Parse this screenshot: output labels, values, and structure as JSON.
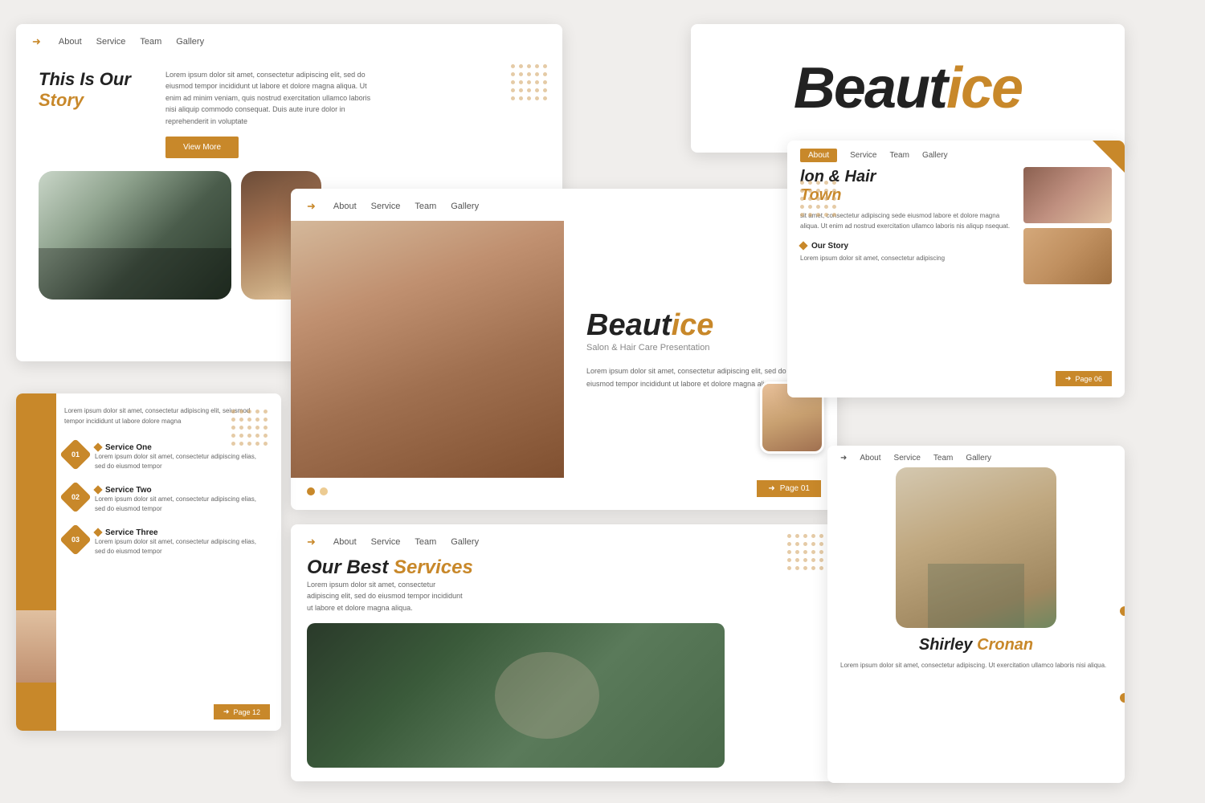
{
  "brand": {
    "name_part1": "Beaut",
    "name_part2": "ice",
    "tagline": "Salon & Hair Care Presentation"
  },
  "slide1": {
    "title_line1": "This Is Our",
    "title_line2": "Story",
    "body": "Lorem ipsum dolor sit amet, consectetur adipiscing elit, sed do eiusmod tempor incididunt ut labore et dolore magna aliqua. Ut enim ad minim veniam, quis nostrud exercitation ullamco laboris nisi aliquip commodo consequat. Duis aute irure dolor in reprehenderit in voluptate",
    "btn_label": "View More",
    "nav": [
      "About",
      "Service",
      "Team",
      "Gallery"
    ]
  },
  "slide2": {
    "logo_p1": "Beaut",
    "logo_p2": "ice"
  },
  "slide3": {
    "logo_p1": "Beaut",
    "logo_p2": "ice",
    "tagline": "Salon & Hair Care Presentation",
    "body": "Lorem ipsum dolor sit amet, consectetur adipiscing elit, sed do eiusmod tempor incididunt ut labore et dolore magna aliqua.",
    "page_num": "Page 01",
    "nav": [
      "About",
      "Service",
      "Team",
      "Gallery"
    ]
  },
  "slide4": {
    "title_partial": "lon & Hair",
    "title_sub": "Town",
    "body": "sit amet, consectetur adipiscing sede eiusmod labore et dolore magna aliqua. Ut enim ad nostrud exercitation ullamco laboris nis aliqup nsequat.",
    "story_label": "Our Story",
    "story_text": "Lorem ipsum dolor sit amet, consectetur adipiscing",
    "page_num": "Page 06",
    "nav": [
      "About",
      "Service",
      "Team",
      "Gallery"
    ]
  },
  "slide5": {
    "body_text": "Lorem ipsum dolor sit amet, consectetur adipiscing elit, seiusmod tempor incididunt ut labore dolore magna",
    "services": [
      {
        "num": "01",
        "title": "Service One",
        "text": "Lorem ipsum dolor sit amet, consectetur adipiscing elias, sed do eiusmod tempor"
      },
      {
        "num": "02",
        "title": "Service Two",
        "text": "Lorem ipsum dolor sit amet, consectetur adipiscing elias, sed do eiusmod tempor"
      },
      {
        "num": "03",
        "title": "Service Three",
        "text": "Lorem ipsum dolor sit amet, consectetur adipiscing elias, sed do eiusmod tempor"
      }
    ],
    "page_num": "Page 12"
  },
  "slide6": {
    "title_p1": "Our Best ",
    "title_p2": "Services",
    "body": "Lorem ipsum dolor sit amet, consectetur adipiscing elit, sed do eiusmod tempor incididunt ut labore et dolore magna aliqua.",
    "nav": [
      "About",
      "Service",
      "Team",
      "Gallery"
    ]
  },
  "slide7": {
    "name_p1": "Shirley ",
    "name_p2": "Cronan",
    "body": "Lorem ipsum dolor sit amet, consectetur adipiscing. Ut exercitation ullamco laboris nisi aliqua.",
    "nav_about": "About",
    "nav": [
      "About",
      "Service",
      "Team",
      "Gallery"
    ]
  },
  "nav_items": [
    "About",
    "Service",
    "Team",
    "Gallery"
  ],
  "page_labels": {
    "page01": "Page 01",
    "page02": "Page 12",
    "page06": "Page 06"
  }
}
